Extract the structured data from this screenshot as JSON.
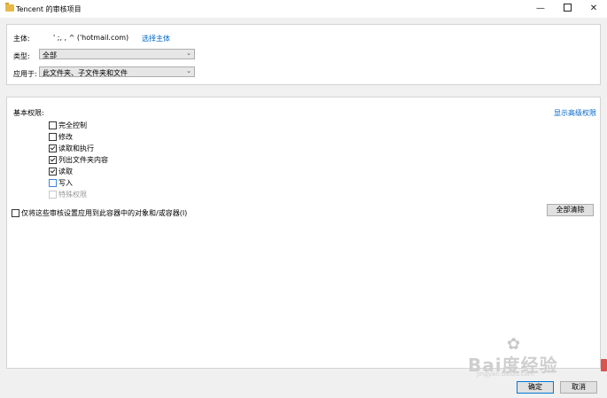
{
  "window": {
    "title": "Tencent 的审核项目",
    "minimize_glyph": "—",
    "close_glyph": "✕"
  },
  "principal": {
    "label": "主体:",
    "value": "'  ;,  ,  ^  ('hotmail.com)",
    "select_link": "选择主体"
  },
  "type": {
    "label": "类型:",
    "value": "全部"
  },
  "applies_to": {
    "label": "应用于:",
    "value": "此文件夹、子文件夹和文件"
  },
  "permissions": {
    "heading": "基本权限:",
    "show_advanced_link": "显示高级权限",
    "items": [
      {
        "label": "完全控制",
        "checked": false,
        "enabled": true
      },
      {
        "label": "修改",
        "checked": false,
        "enabled": true
      },
      {
        "label": "读取和执行",
        "checked": true,
        "enabled": true
      },
      {
        "label": "列出文件夹内容",
        "checked": true,
        "enabled": true
      },
      {
        "label": "读取",
        "checked": true,
        "enabled": true
      },
      {
        "label": "写入",
        "checked": false,
        "enabled": true
      },
      {
        "label": "特殊权限",
        "checked": false,
        "enabled": false
      }
    ],
    "apply_only_label": "仅将这些审核设置应用到此容器中的对象和/或容器(I)",
    "clear_all_label": "全部清除"
  },
  "footer": {
    "ok_label": "确定",
    "cancel_label": "取消"
  },
  "watermark": {
    "brand": "Bai度经验",
    "url": "jingyan.baidu.com"
  }
}
